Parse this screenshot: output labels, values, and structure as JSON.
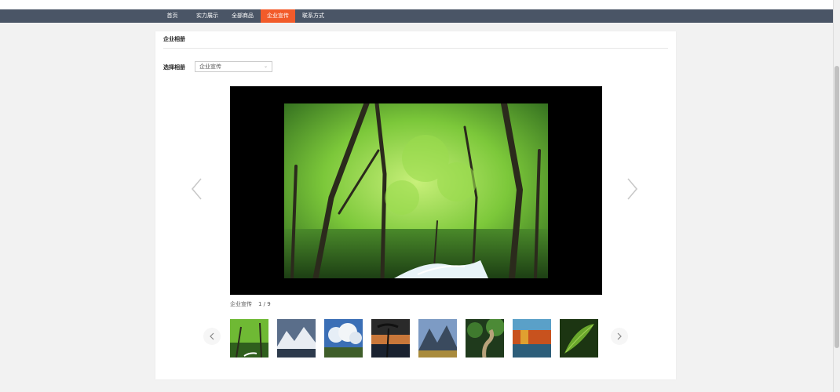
{
  "nav": {
    "items": [
      {
        "label": "首页",
        "active": false
      },
      {
        "label": "实力展示",
        "active": false
      },
      {
        "label": "全部商品",
        "active": false
      },
      {
        "label": "企业宣传",
        "active": true
      },
      {
        "label": "联系方式",
        "active": false
      }
    ],
    "bar_color": "#4a5566",
    "active_color": "#f25b2a"
  },
  "panel": {
    "title": "企业相册",
    "album_label": "选择相册",
    "album_selected": "企业宣传"
  },
  "viewer": {
    "caption_name": "企业宣传",
    "caption_count": "1 / 9",
    "prev_icon": "chevron-left-icon",
    "next_icon": "chevron-right-icon"
  },
  "thumbnails": [
    {
      "subject": "green forest with stream",
      "selected": true
    },
    {
      "subject": "snowy mountains"
    },
    {
      "subject": "clouds over field"
    },
    {
      "subject": "sunset with palm tree"
    },
    {
      "subject": "mountain valley"
    },
    {
      "subject": "forest boardwalk path"
    },
    {
      "subject": "autumn lake"
    },
    {
      "subject": "green leaf close-up"
    }
  ]
}
